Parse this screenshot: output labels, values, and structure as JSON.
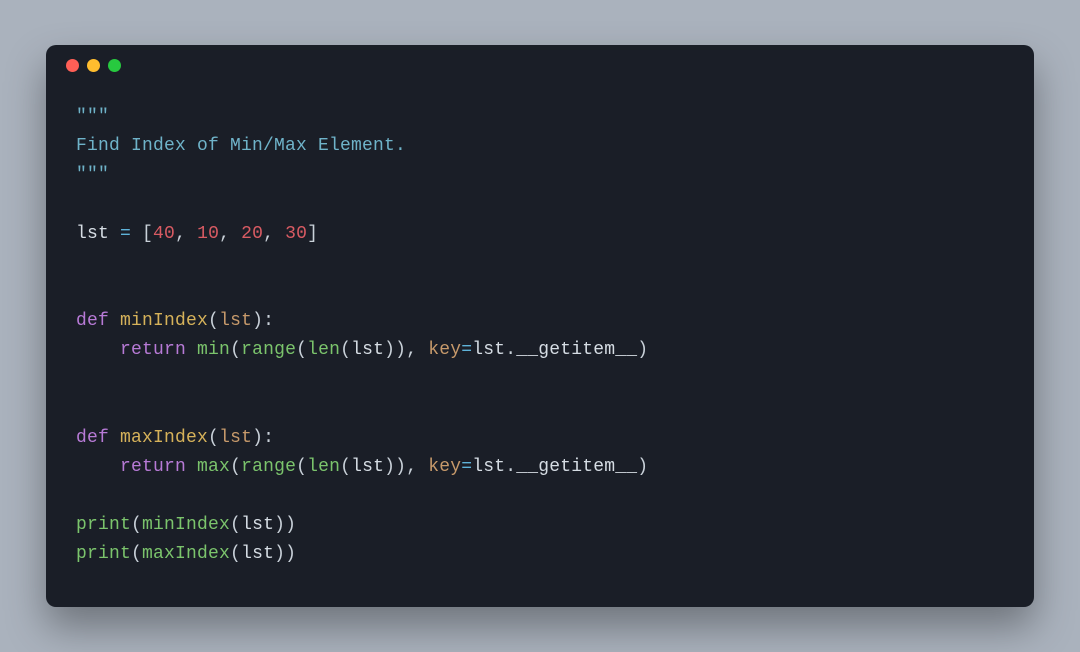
{
  "titlebar": {
    "dots": [
      "red",
      "yellow",
      "green"
    ]
  },
  "code": {
    "docOpen": "\"\"\"",
    "docText": "Find Index of Min/Max Element.",
    "docClose": "\"\"\"",
    "lstName": "lst",
    "eq": " = ",
    "lb": "[",
    "rb": "]",
    "n40": "40",
    "n10": "10",
    "n20": "20",
    "n30": "30",
    "comma": ", ",
    "kwDef": "def",
    "kwReturn": "return",
    "fnMinIndex": "minIndex",
    "fnMaxIndex": "maxIndex",
    "paramLst": "lst",
    "lp": "(",
    "rp": ")",
    "colon": ":",
    "indent": "    ",
    "builtinMin": "min",
    "builtinMax": "max",
    "builtinRange": "range",
    "builtinLen": "len",
    "builtinPrint": "print",
    "kwKey": "key",
    "dot": ".",
    "getitem": "__getitem__",
    "argLst": "lst"
  }
}
